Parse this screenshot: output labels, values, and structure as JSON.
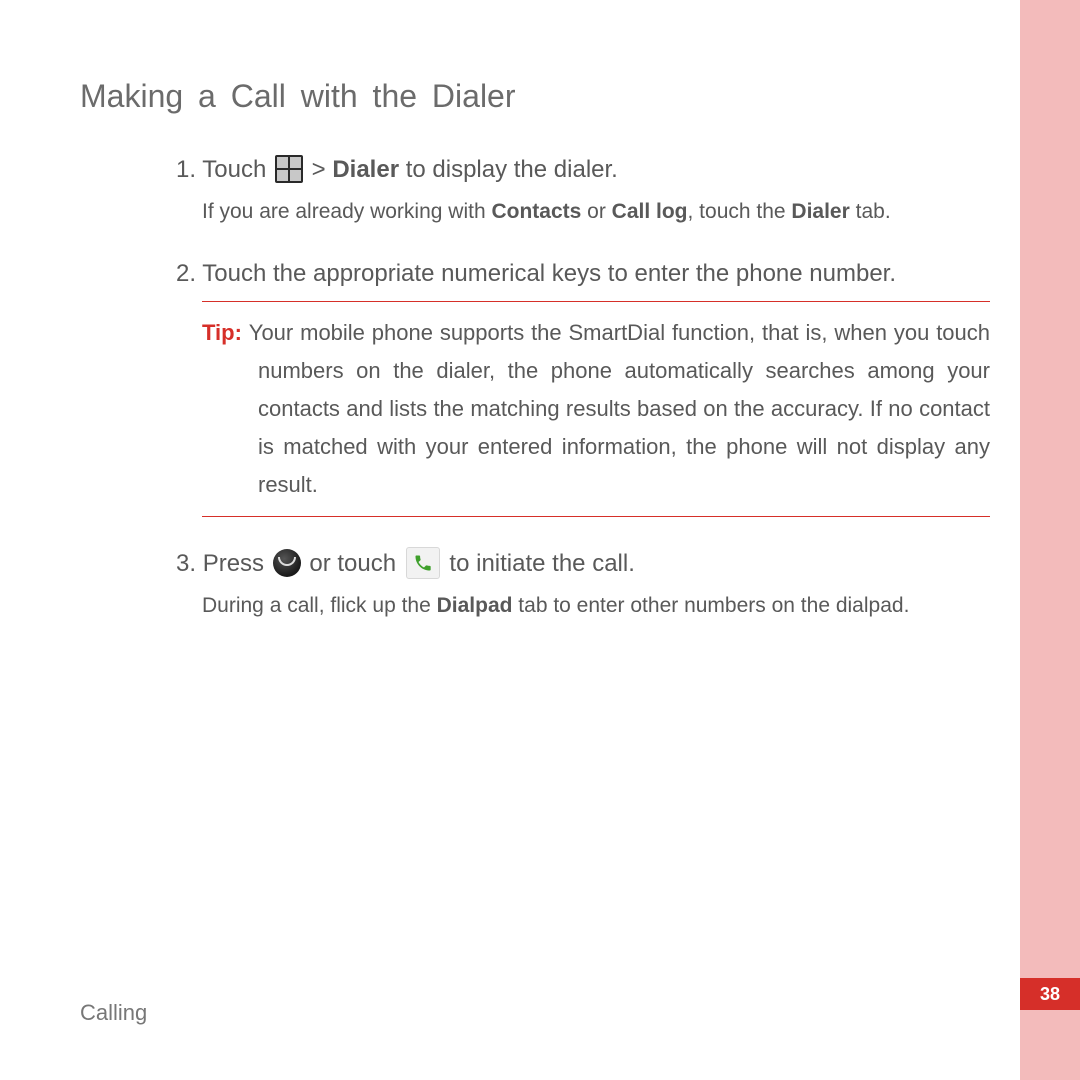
{
  "heading": "Making a Call with the Dialer",
  "steps": {
    "s1": {
      "num": "1.",
      "pre": "Touch ",
      "sep": " > ",
      "bold": "Dialer",
      "post": " to display the dialer."
    },
    "s1_sub": {
      "a": "If you are already working with ",
      "b": "Contacts",
      "c": " or ",
      "d": "Call log",
      "e": ", touch the ",
      "f": "Dialer",
      "g": " tab."
    },
    "s2": {
      "num": "2.",
      "text": "Touch the appropriate numerical keys to enter the phone number."
    },
    "tip": {
      "label": "Tip:  ",
      "text": "Your mobile phone supports the SmartDial function, that is, when you touch numbers on the dialer, the phone automatically searches among your contacts and lists the matching results based on the accuracy. If no contact is matched with your entered information, the phone will not display any result."
    },
    "s3": {
      "num": "3.",
      "a": "Press ",
      "b": " or touch ",
      "c": " to initiate the call."
    },
    "s3_sub": {
      "a": "During a call, flick up the ",
      "b": "Dialpad",
      "c": " tab to enter other numbers on the dialpad."
    }
  },
  "footer": "Calling",
  "page_number": "38"
}
